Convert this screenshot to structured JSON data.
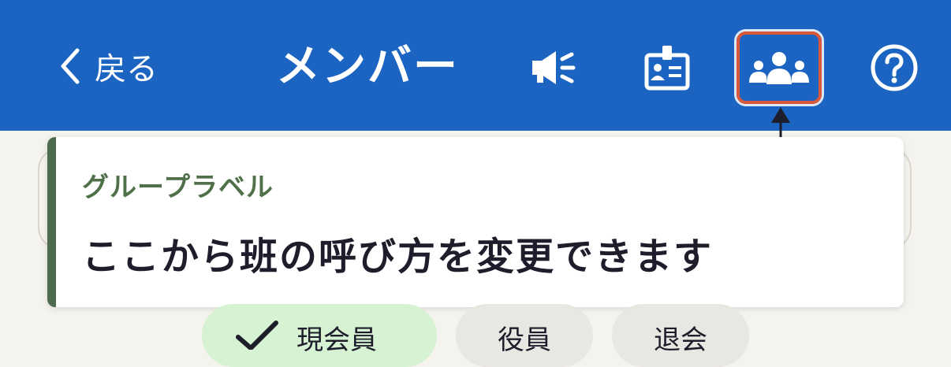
{
  "header": {
    "back_label": "戻る",
    "title": "メンバー",
    "icons": [
      "announcement-icon",
      "id-card-icon",
      "group-icon",
      "help-icon"
    ]
  },
  "tooltip": {
    "title": "グループラベル",
    "body": "ここから班の呼び方を変更できます"
  },
  "filters": [
    {
      "label": "現会員",
      "selected": true
    },
    {
      "label": "役員",
      "selected": false
    },
    {
      "label": "退会",
      "selected": false
    }
  ],
  "colors": {
    "header": "#1c64c2",
    "highlight_border": "#d9573a",
    "tooltip_accent": "#4f6b4f",
    "chip_selected": "#d6f2d2"
  }
}
